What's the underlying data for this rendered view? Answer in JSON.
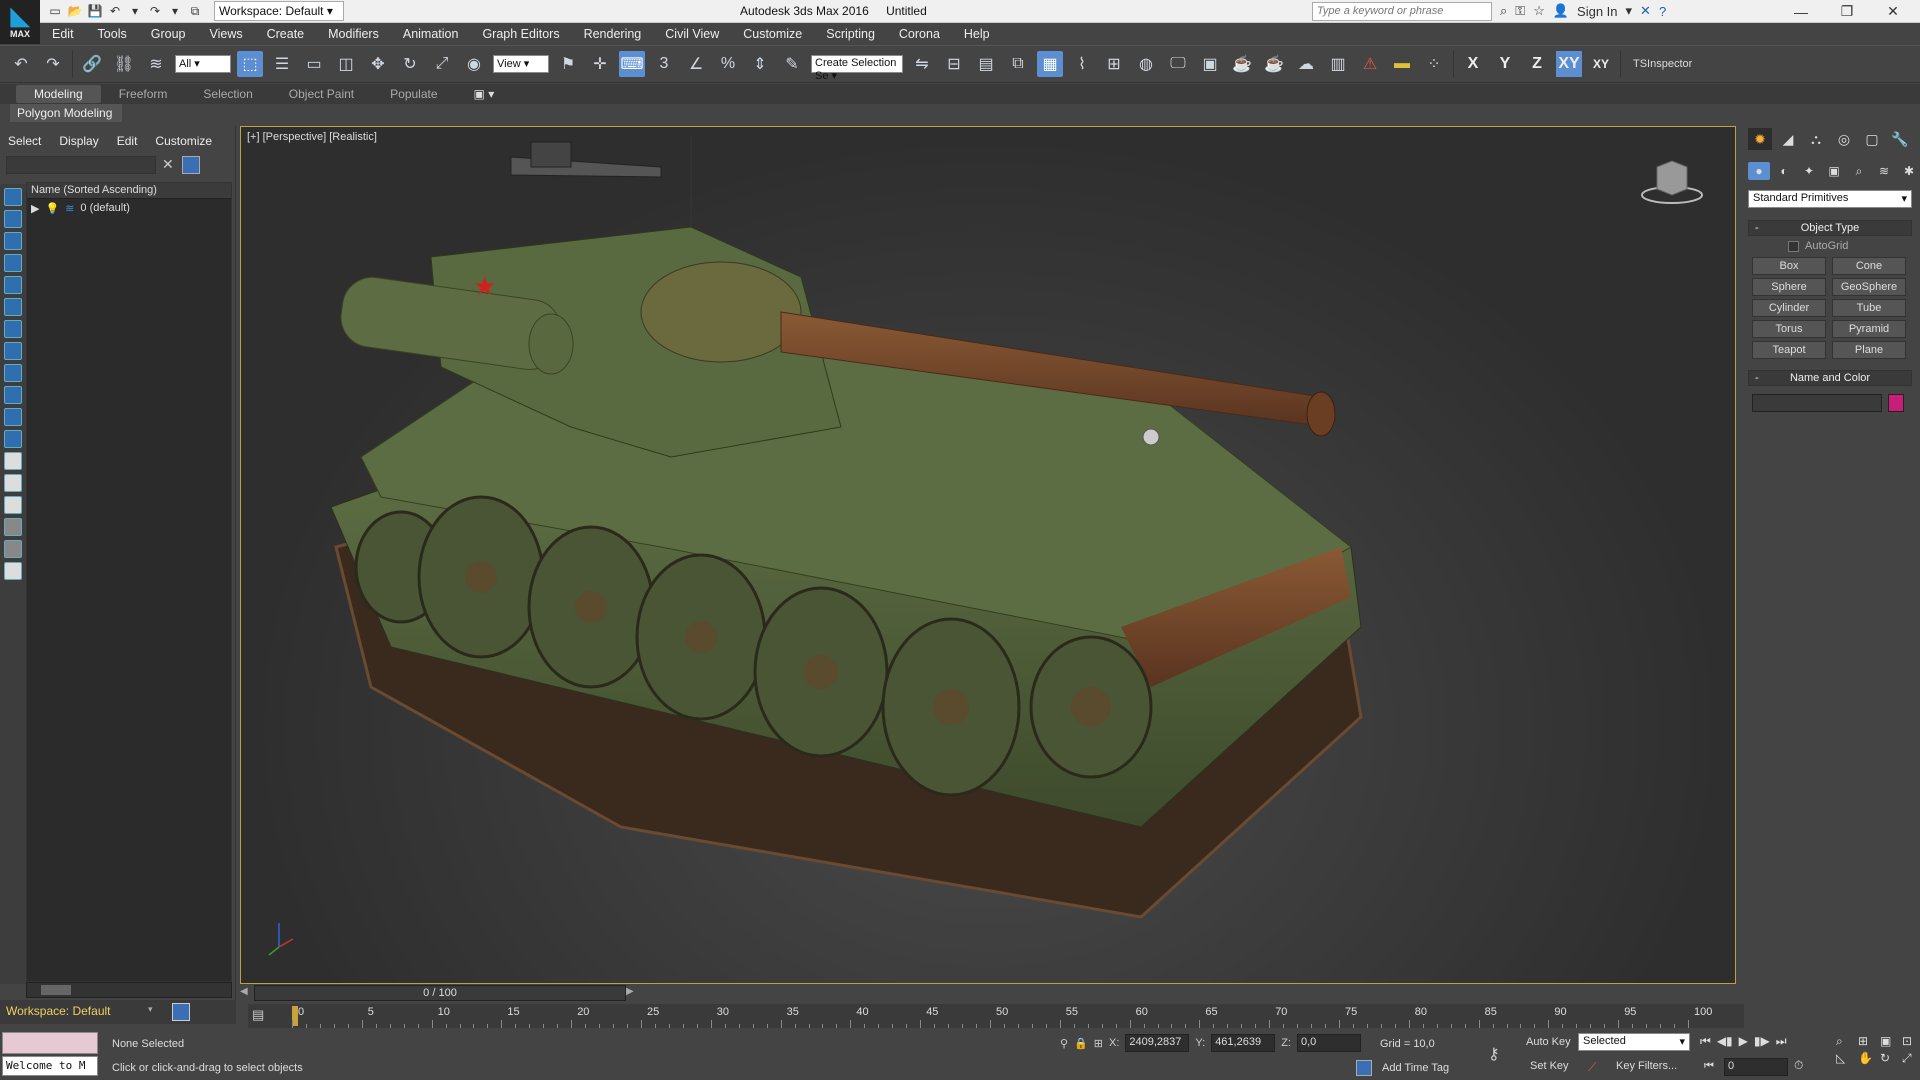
{
  "titlebar": {
    "workspace": "Workspace: Default",
    "app_name": "Autodesk 3ds Max 2016",
    "document": "Untitled",
    "search_placeholder": "Type a keyword or phrase",
    "sign_in": "Sign In",
    "logo_text": "MAX"
  },
  "menu": [
    "Edit",
    "Tools",
    "Group",
    "Views",
    "Create",
    "Modifiers",
    "Animation",
    "Graph Editors",
    "Rendering",
    "Civil View",
    "Customize",
    "Scripting",
    "Corona",
    "Help"
  ],
  "toolbar": {
    "selection_filter": "All",
    "ref_coord": "View",
    "named_selection": "Create Selection Se",
    "axis": [
      "X",
      "Y",
      "Z",
      "XY",
      "XY"
    ],
    "tsinspector": "TSInspector"
  },
  "ribbon": {
    "tabs": [
      "Modeling",
      "Freeform",
      "Selection",
      "Object Paint",
      "Populate"
    ],
    "sub": "Polygon Modeling"
  },
  "scene_explorer": {
    "menu": [
      "Select",
      "Display",
      "Edit",
      "Customize"
    ],
    "header": "Name (Sorted Ascending)",
    "rows": [
      "0 (default)"
    ]
  },
  "viewport": {
    "label": "[+] [Perspective] [Realistic]"
  },
  "command_panel": {
    "dropdown": "Standard Primitives",
    "object_type_title": "Object Type",
    "autogrid": "AutoGrid",
    "primitives": [
      "Box",
      "Cone",
      "Sphere",
      "GeoSphere",
      "Cylinder",
      "Tube",
      "Torus",
      "Pyramid",
      "Teapot",
      "Plane"
    ],
    "name_color_title": "Name and Color",
    "swatch_color": "#c81e7a"
  },
  "timeslider": {
    "frame": "0 / 100"
  },
  "workspace_footer": "Workspace: Default",
  "trackbar": {
    "ticks": [
      "0",
      "5",
      "10",
      "15",
      "20",
      "25",
      "30",
      "35",
      "40",
      "45",
      "50",
      "55",
      "60",
      "65",
      "70",
      "75",
      "80",
      "85",
      "90",
      "95",
      "100"
    ]
  },
  "status": {
    "maxscript": "Welcome to M",
    "selection": "None Selected",
    "prompt": "Click or click-and-drag to select objects",
    "x_label": "X:",
    "x": "2409,2837",
    "y_label": "Y:",
    "y": "461,2639",
    "z_label": "Z:",
    "z": "0,0",
    "grid": "Grid = 10,0",
    "add_time_tag": "Add Time Tag",
    "auto_key": "Auto Key",
    "set_key": "Set Key",
    "selected": "Selected",
    "key_filters": "Key Filters...",
    "frame": "0"
  },
  "colors": {
    "accent": "#5b8fd1",
    "viewport_border": "#c0a040",
    "tank_green": "#4e5e3a",
    "rust": "#7a4a2a"
  }
}
